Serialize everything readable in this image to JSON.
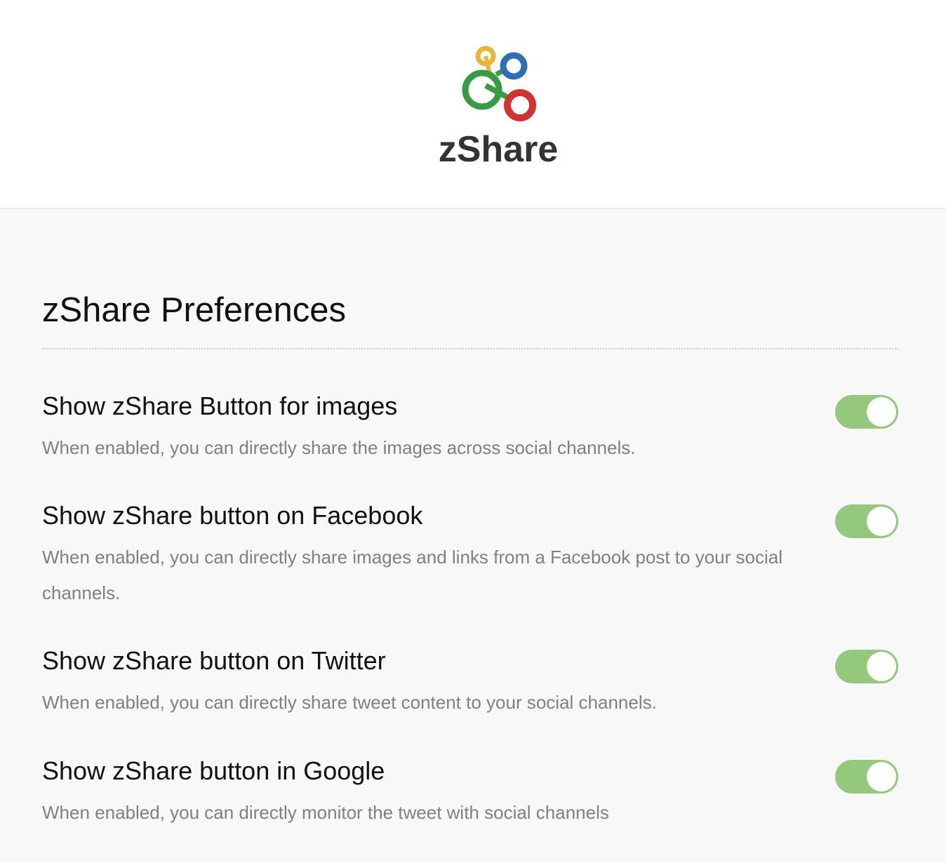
{
  "header": {
    "logo_icon": "zshare-rings-logo",
    "brand": "zShare"
  },
  "main": {
    "title": "zShare Preferences",
    "preferences": [
      {
        "title": "Show zShare Button for images",
        "description": "When enabled, you can directly share the images across social channels.",
        "enabled": true
      },
      {
        "title": "Show zShare button on Facebook",
        "description": "When enabled, you can directly share images and links from a Facebook post to your social channels.",
        "enabled": true
      },
      {
        "title": "Show zShare button on Twitter",
        "description": "When enabled, you can directly share tweet content to your social channels.",
        "enabled": true
      },
      {
        "title": "Show zShare button in Google",
        "description": "When enabled, you can directly monitor the tweet with social channels",
        "enabled": true
      }
    ]
  },
  "colors": {
    "toggle_on": "#94c97d",
    "ring_yellow": "#e9b43a",
    "ring_blue": "#2f6db5",
    "ring_green": "#3a9b47",
    "ring_red": "#d23330",
    "brand_text": "#333333",
    "description_text": "#808080"
  }
}
